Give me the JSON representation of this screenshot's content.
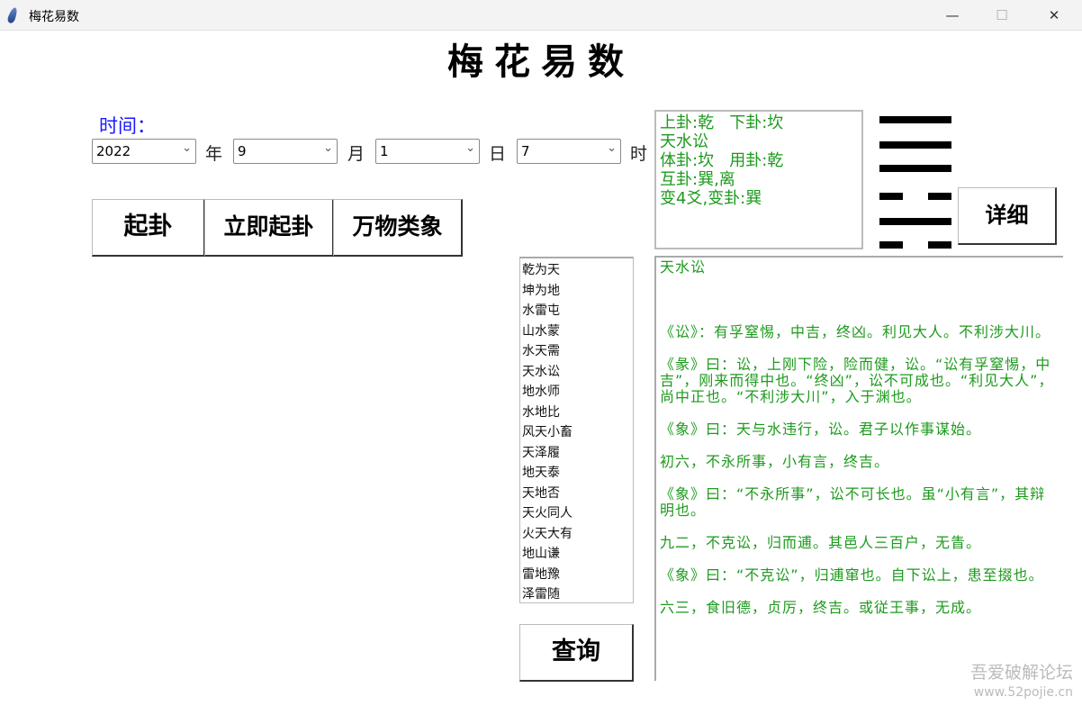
{
  "window": {
    "title": "梅花易数",
    "minimize": "—",
    "maximize": "☐",
    "close": "✕"
  },
  "app_title": "梅花易数",
  "time_label": "时间：",
  "date": {
    "year": "2022",
    "month": "9",
    "day": "1",
    "hour": "7",
    "year_unit": "年",
    "month_unit": "月",
    "day_unit": "日",
    "hour_unit": "时"
  },
  "buttons": {
    "cast": "起卦",
    "cast_now": "立即起卦",
    "wanwu": "万物类象",
    "detail": "详细",
    "query": "查询"
  },
  "hexagram_list": [
    "乾为天",
    "坤为地",
    "水雷屯",
    "山水蒙",
    "水天需",
    "天水讼",
    "地水师",
    "水地比",
    "风天小畜",
    "天泽履",
    "地天泰",
    "天地否",
    "天火同人",
    "火天大有",
    "地山谦",
    "雷地豫",
    "泽雷随"
  ],
  "info_text": "上卦:乾   下卦:坎\n天水讼\n体卦:坎   用卦:乾\n互卦:巽,离\n变4爻,变卦:巽",
  "hexagram_lines": [
    1,
    1,
    1,
    0,
    1,
    0
  ],
  "detail": {
    "paragraphs": [
      "天水讼",
      "《讼》：有孚窒惕，中吉，终凶。利见大人。不利涉大川。",
      "《彖》曰：讼，上刚下险，险而健，讼。“讼有孚窒惕，中吉”，刚来而得中也。“终凶”，讼不可成也。“利见大人”，尚中正也。“不利涉大川”，入于渊也。",
      "《象》曰：天与水违行，讼。君子以作事谋始。",
      "初六，不永所事，小有言，终吉。",
      "《象》曰：“不永所事”，讼不可长也。虽“小有言”，其辩明也。",
      "九二，不克讼，归而逋。其邑人三百户，无眚。",
      "《象》曰：“不克讼”，归逋窜也。自下讼上，患至掇也。",
      "六三，食旧德，贞厉，终吉。或従王事，无成。"
    ]
  },
  "watermark": {
    "site": "吾爱破解论坛",
    "url": "www.52pojie.cn"
  }
}
